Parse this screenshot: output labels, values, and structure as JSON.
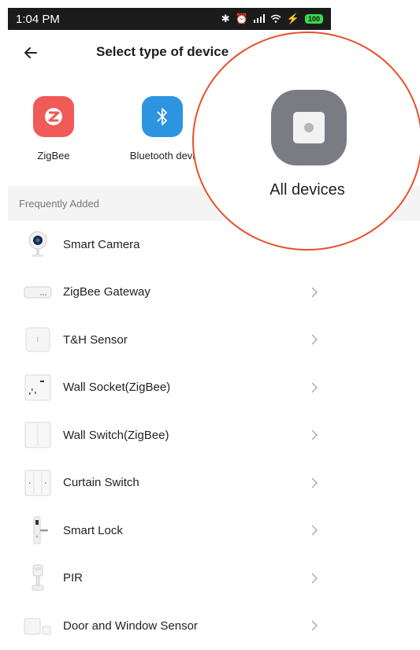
{
  "status_bar": {
    "time": "1:04 PM",
    "icons": [
      "bluetooth-icon",
      "alarm-icon",
      "signal-icon",
      "wifi-icon",
      "power-icon"
    ],
    "battery": "100"
  },
  "header": {
    "title": "Select type of device"
  },
  "device_types": [
    {
      "label": "ZigBee",
      "icon": "zigbee-icon",
      "color": "#f05a57"
    },
    {
      "label": "Bluetooth devi",
      "icon": "bluetooth-icon",
      "color": "#2d95e0"
    }
  ],
  "section": {
    "title": "Frequently Added"
  },
  "devices": [
    {
      "name": "Smart Camera",
      "icon": "camera-icon"
    },
    {
      "name": "ZigBee Gateway",
      "icon": "gateway-icon"
    },
    {
      "name": "T&H Sensor",
      "icon": "sensor-icon"
    },
    {
      "name": "Wall Socket(ZigBee)",
      "icon": "socket-icon"
    },
    {
      "name": "Wall Switch(ZigBee)",
      "icon": "switch-icon"
    },
    {
      "name": "Curtain Switch",
      "icon": "curtain-switch-icon"
    },
    {
      "name": "Smart Lock",
      "icon": "lock-icon"
    },
    {
      "name": "PIR",
      "icon": "pir-icon"
    },
    {
      "name": "Door and Window Sensor",
      "icon": "door-sensor-icon"
    }
  ],
  "callout": {
    "label": "All devices",
    "icon": "all-devices-icon",
    "ring_color": "#e8502a"
  }
}
